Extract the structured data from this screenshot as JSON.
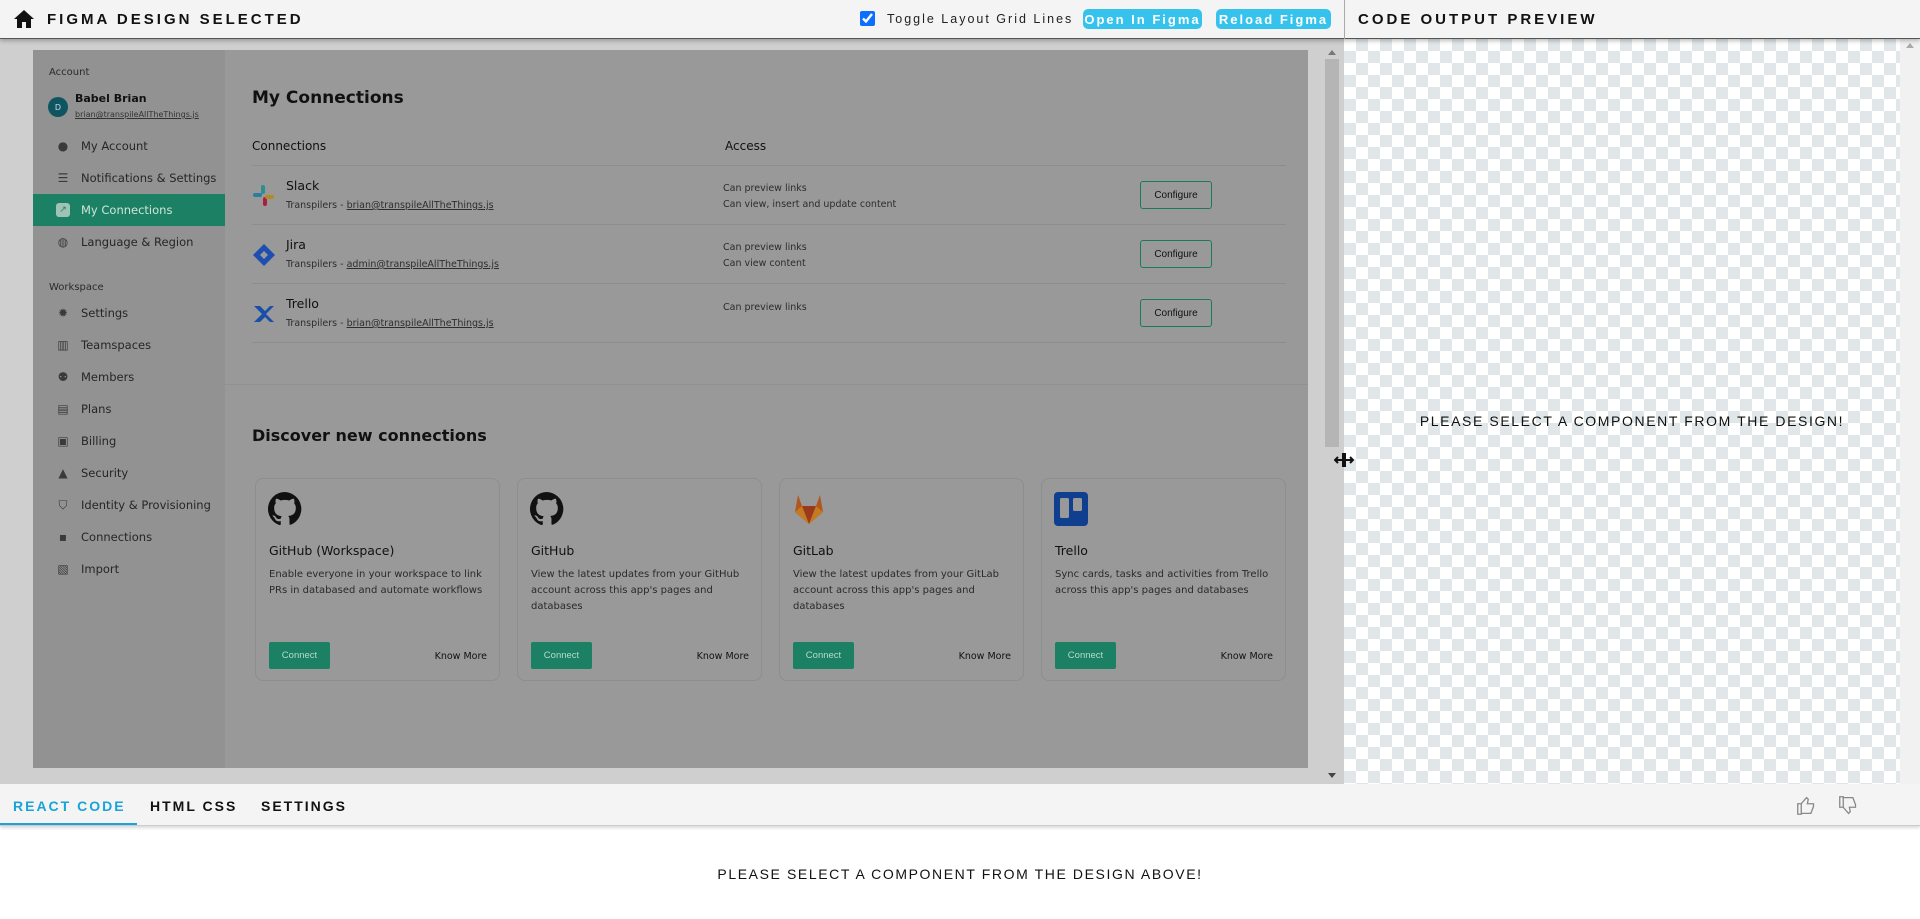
{
  "topbar": {
    "title": "FIGMA DESIGN SELECTED",
    "grid_toggle_label": "Toggle Layout Grid Lines",
    "grid_toggle_checked": true,
    "open_figma": "Open In Figma",
    "reload_figma": "Reload Figma",
    "preview_title": "CODE OUTPUT PREVIEW"
  },
  "design": {
    "sidebar": {
      "account_label": "Account",
      "user": {
        "initial": "D",
        "name": "Babel Brian",
        "email": "brian@transpileAllTheThings.js"
      },
      "account_items": [
        {
          "label": "My Account",
          "icon": "user-icon"
        },
        {
          "label": "Notifications & Settings",
          "icon": "sliders-icon"
        },
        {
          "label": "My Connections",
          "icon": "link-icon",
          "active": true
        },
        {
          "label": "Language & Region",
          "icon": "globe-icon"
        }
      ],
      "workspace_label": "Workspace",
      "workspace_items": [
        {
          "label": "Settings",
          "icon": "gear-icon"
        },
        {
          "label": "Teamspaces",
          "icon": "building-icon"
        },
        {
          "label": "Members",
          "icon": "people-icon"
        },
        {
          "label": "Plans",
          "icon": "book-icon"
        },
        {
          "label": "Billing",
          "icon": "billing-icon"
        },
        {
          "label": "Security",
          "icon": "lock-icon"
        },
        {
          "label": "Identity & Provisioning",
          "icon": "shield-icon"
        },
        {
          "label": "Connections",
          "icon": "grid-icon"
        },
        {
          "label": "Import",
          "icon": "import-icon"
        }
      ]
    },
    "heading": "My Connections",
    "col_connections": "Connections",
    "col_access": "Access",
    "connections": [
      {
        "name": "Slack",
        "icon": "slack-icon",
        "team": "Transpilers - ",
        "account": "brian@transpileAllTheThings.js",
        "access": [
          "Can preview links",
          "Can view, insert and update content"
        ],
        "button": "Configure"
      },
      {
        "name": "Jira",
        "icon": "jira-icon",
        "team": "Transpilers - ",
        "account": "admin@transpileAllTheThings.js",
        "access": [
          "Can preview links",
          "Can view  content"
        ],
        "button": "Configure"
      },
      {
        "name": "Trello",
        "icon": "trello-icon",
        "team": "Transpilers - ",
        "account": "brian@transpileAllTheThings.js",
        "access": [
          "Can preview links"
        ],
        "button": "Configure"
      }
    ],
    "discover_heading": "Discover new connections",
    "cards": [
      {
        "title": "GitHub (Workspace)",
        "icon": "github-icon",
        "desc": "Enable everyone in your workspace to link PRs in databased and automate workflows",
        "connect": "Connect",
        "more": "Know More"
      },
      {
        "title": "GitHub",
        "icon": "github-icon",
        "desc": "View the latest updates from your GitHub account across this app's pages and databases",
        "connect": "Connect",
        "more": "Know More"
      },
      {
        "title": "GitLab",
        "icon": "gitlab-icon",
        "desc": "View the latest updates from your GitLab account across this app's pages and databases",
        "connect": "Connect",
        "more": "Know More"
      },
      {
        "title": "Trello",
        "icon": "trello-icon",
        "desc": "Sync cards, tasks and activities from Trello across this app's pages and databases",
        "connect": "Connect",
        "more": "Know More"
      }
    ]
  },
  "preview": {
    "message": "PLEASE SELECT A COMPONENT FROM THE DESIGN!"
  },
  "bottom": {
    "tabs": [
      "REACT CODE",
      "HTML CSS",
      "SETTINGS"
    ],
    "active_tab": 0,
    "message": "PLEASE SELECT A COMPONENT FROM THE DESIGN ABOVE!"
  },
  "colors": {
    "accent": "#35c3ee",
    "brand_green": "#1b8064"
  }
}
